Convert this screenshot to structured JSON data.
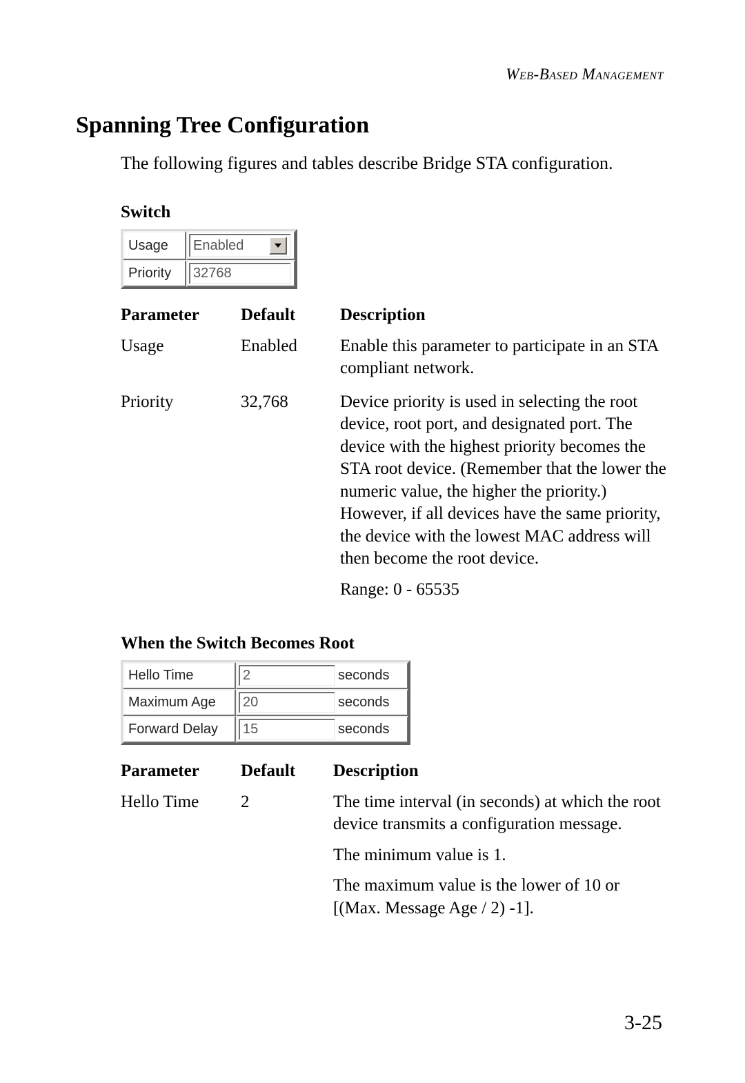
{
  "header": "Web-Based Management",
  "section_heading": "Spanning Tree Configuration",
  "intro": "The following figures and tables describe Bridge STA configuration.",
  "switch": {
    "heading": "Switch",
    "fields": {
      "usage_label": "Usage",
      "usage_value": "Enabled",
      "priority_label": "Priority",
      "priority_value": "32768"
    },
    "table": {
      "headers": {
        "param": "Parameter",
        "default": "Default",
        "desc": "Description"
      },
      "rows": [
        {
          "param": "Usage",
          "default": "Enabled",
          "desc": [
            "Enable this parameter to participate in an STA compliant network."
          ]
        },
        {
          "param": "Priority",
          "default": "32,768",
          "desc": [
            "Device priority is used in selecting the root device, root port, and designated port.  The device with the highest priority becomes the STA root device. (Remember that the lower the numeric value, the higher the priority.) However, if all devices have the same priority, the device with the lowest MAC address will then become the root device.",
            "Range: 0 - 65535"
          ]
        }
      ]
    }
  },
  "root": {
    "heading": "When the Switch Becomes Root",
    "fields": {
      "hello_label": "Hello Time",
      "hello_value": "2",
      "maxage_label": "Maximum Age",
      "maxage_value": "20",
      "fwd_label": "Forward Delay",
      "fwd_value": "15",
      "unit": "seconds"
    },
    "table": {
      "headers": {
        "param": "Parameter",
        "default": "Default",
        "desc": "Description"
      },
      "rows": [
        {
          "param": "Hello Time",
          "default": "2",
          "desc": [
            "The time interval (in seconds) at which the root device transmits a configuration message.",
            "The minimum value is 1.",
            "The maximum value is the lower of 10 or [(Max. Message Age / 2) -1]."
          ]
        }
      ]
    }
  },
  "page_number": "3-25"
}
